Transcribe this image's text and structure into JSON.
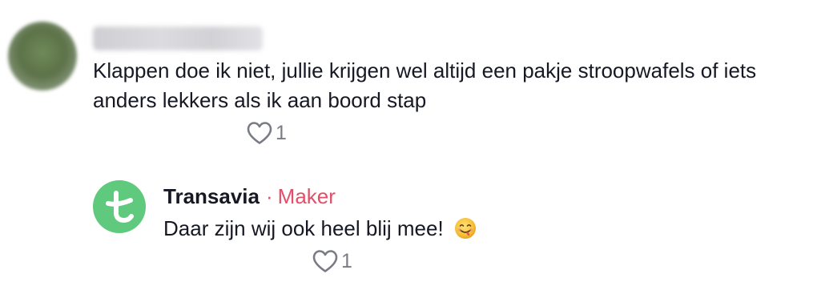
{
  "comment": {
    "text": "Klappen doe ik niet, jullie krijgen wel altijd een pakje stroopwafels of iets anders lekkers als ik aan boord stap",
    "likes": "1"
  },
  "reply": {
    "author": "Transavia",
    "separator": "·",
    "role": "Maker",
    "text": "Daar zijn wij ook heel blij mee!",
    "emoji": "face-savoring-food-emoji",
    "likes": "1"
  },
  "colors": {
    "brand_green": "#5fc97d",
    "maker_red": "#e34f68",
    "text": "#161823",
    "muted": "#7a7c85"
  }
}
